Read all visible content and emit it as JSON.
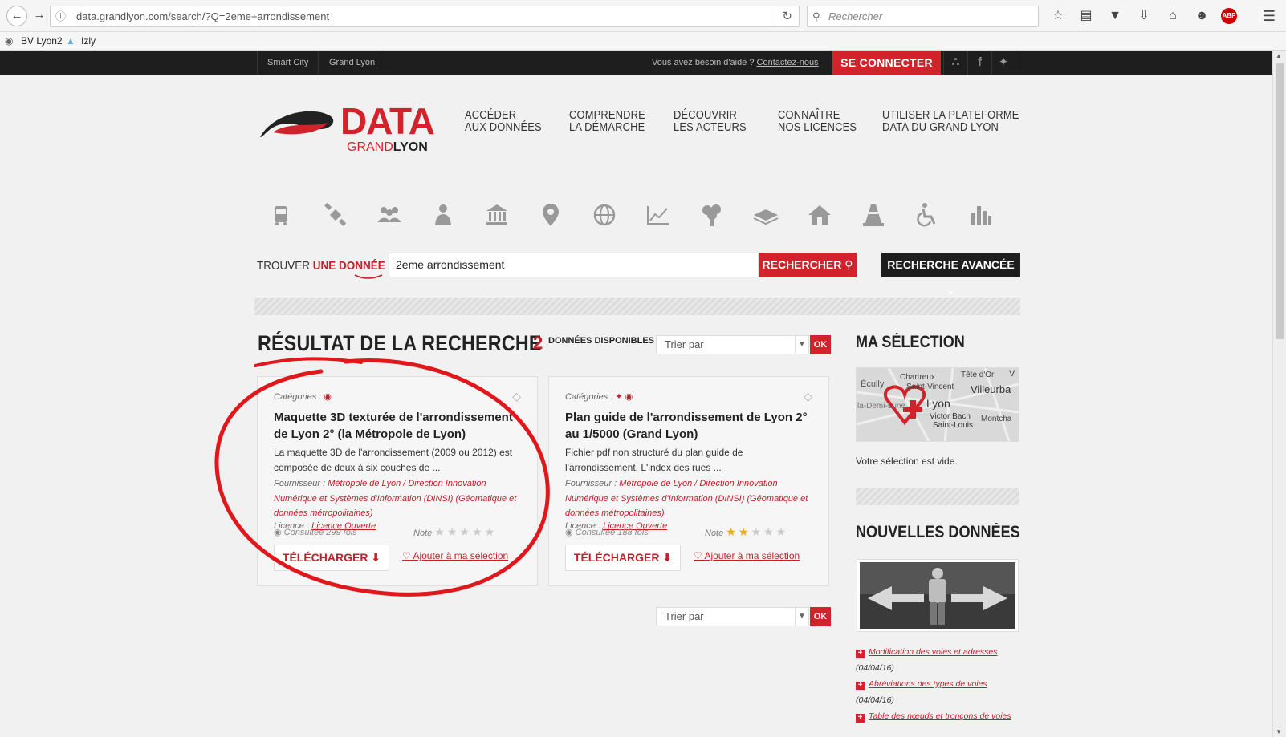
{
  "browser": {
    "url": "data.grandlyon.com/search/?Q=2eme+arrondissement",
    "search_placeholder": "Rechercher",
    "bookmarks": [
      "BV Lyon2",
      "Izly"
    ],
    "abp": "ABP"
  },
  "topbar": {
    "links": [
      "Smart City",
      "Grand Lyon"
    ],
    "help_text": "Vous avez besoin d'aide ?",
    "help_link": "Contactez-nous",
    "connect": "SE CONNECTER",
    "social": [
      "rss-icon",
      "facebook-icon",
      "twitter-icon"
    ]
  },
  "logo": {
    "word": "DATA",
    "grand": "GRAND",
    "lyon": "LYON"
  },
  "nav": [
    {
      "l1": "ACCÉDER",
      "l2": "AUX DONNÉES"
    },
    {
      "l1": "COMPRENDRE",
      "l2": "LA DÉMARCHE"
    },
    {
      "l1": "DÉCOUVRIR",
      "l2": "LES ACTEURS"
    },
    {
      "l1": "CONNAÎTRE",
      "l2": "NOS LICENCES"
    },
    {
      "l1": "UTILISER LA PLATEFORME",
      "l2": "DATA DU GRAND LYON"
    }
  ],
  "categories": [
    "bus-icon",
    "satellite-icon",
    "people-group-icon",
    "person-icon",
    "institution-icon",
    "map-pin-icon",
    "globe-icon",
    "line-chart-icon",
    "tree-icon",
    "layers-icon",
    "home-icon",
    "traffic-cone-icon",
    "accessibility-icon",
    "bar-chart-icon"
  ],
  "search": {
    "label_prefix": "TROUVER",
    "label_red": "UNE DONNÉE",
    "value": "2eme arrondissement",
    "button": "RECHERCHER",
    "advanced": "RECHERCHE AVANCÉE"
  },
  "results": {
    "title": "RÉSULTAT DE LA RECHERCHE",
    "count": "2",
    "available": "DONNÉES DISPONIBLES",
    "sort_placeholder": "Trier par",
    "ok": "OK",
    "cards": [
      {
        "categories_label": "Catégories :",
        "title": "Maquette 3D texturée de l'arrondissement de Lyon 2° (la Métropole de Lyon)",
        "desc": "La maquette 3D de l'arrondissement (2009 ou 2012) est composée de deux à six couches de ...",
        "provider_label": "Fournisseur :",
        "provider": "Métropole de Lyon / Direction Innovation Numérique et Systèmes d'Information (DINSI) (Géomatique et données métropolitaines)",
        "licence_label": "Licence :",
        "licence": "Licence Ouverte",
        "views": "Consultée 299 fois",
        "note_label": "Note",
        "rating": 0,
        "download": "TÉLÉCHARGER",
        "add": "Ajouter à ma sélection"
      },
      {
        "categories_label": "Catégories :",
        "title": "Plan guide de l'arrondissement de Lyon 2° au 1/5000 (Grand Lyon)",
        "desc": "Fichier pdf non structuré du plan guide de l'arrondissement. L'index des rues ...",
        "provider_label": "Fournisseur :",
        "provider": "Métropole de Lyon / Direction Innovation Numérique et Systèmes d'Information (DINSI) (Géomatique et données métropolitaines)",
        "licence_label": "Licence :",
        "licence": "Licence Ouverte",
        "views": "Consultée 188 fois",
        "note_label": "Note",
        "rating": 2,
        "download": "TÉLÉCHARGER",
        "add": "Ajouter à ma sélection"
      }
    ]
  },
  "sidebar": {
    "selection_title": "MA SÉLECTION",
    "map_labels": [
      "Chartreux",
      "Saint-Vincent",
      "Tête d'Or",
      "Écully",
      "Villeurba",
      "la-Demi-Lune",
      "Lyon",
      "Victor Bach",
      "Saint-Louis",
      "Montcha",
      "V"
    ],
    "empty": "Votre sélection est vide.",
    "news_title": "NOUVELLES DONNÉES",
    "news": [
      {
        "title": "Modification des voies et adresses",
        "date": "(04/04/16)"
      },
      {
        "title": "Abréviations des types de voies",
        "date": "(04/04/16)"
      },
      {
        "title": "Table des nœuds et tronçons de voies",
        "date": ""
      }
    ]
  },
  "colors": {
    "accent": "#d2222b",
    "dark": "#1e1e1e"
  }
}
